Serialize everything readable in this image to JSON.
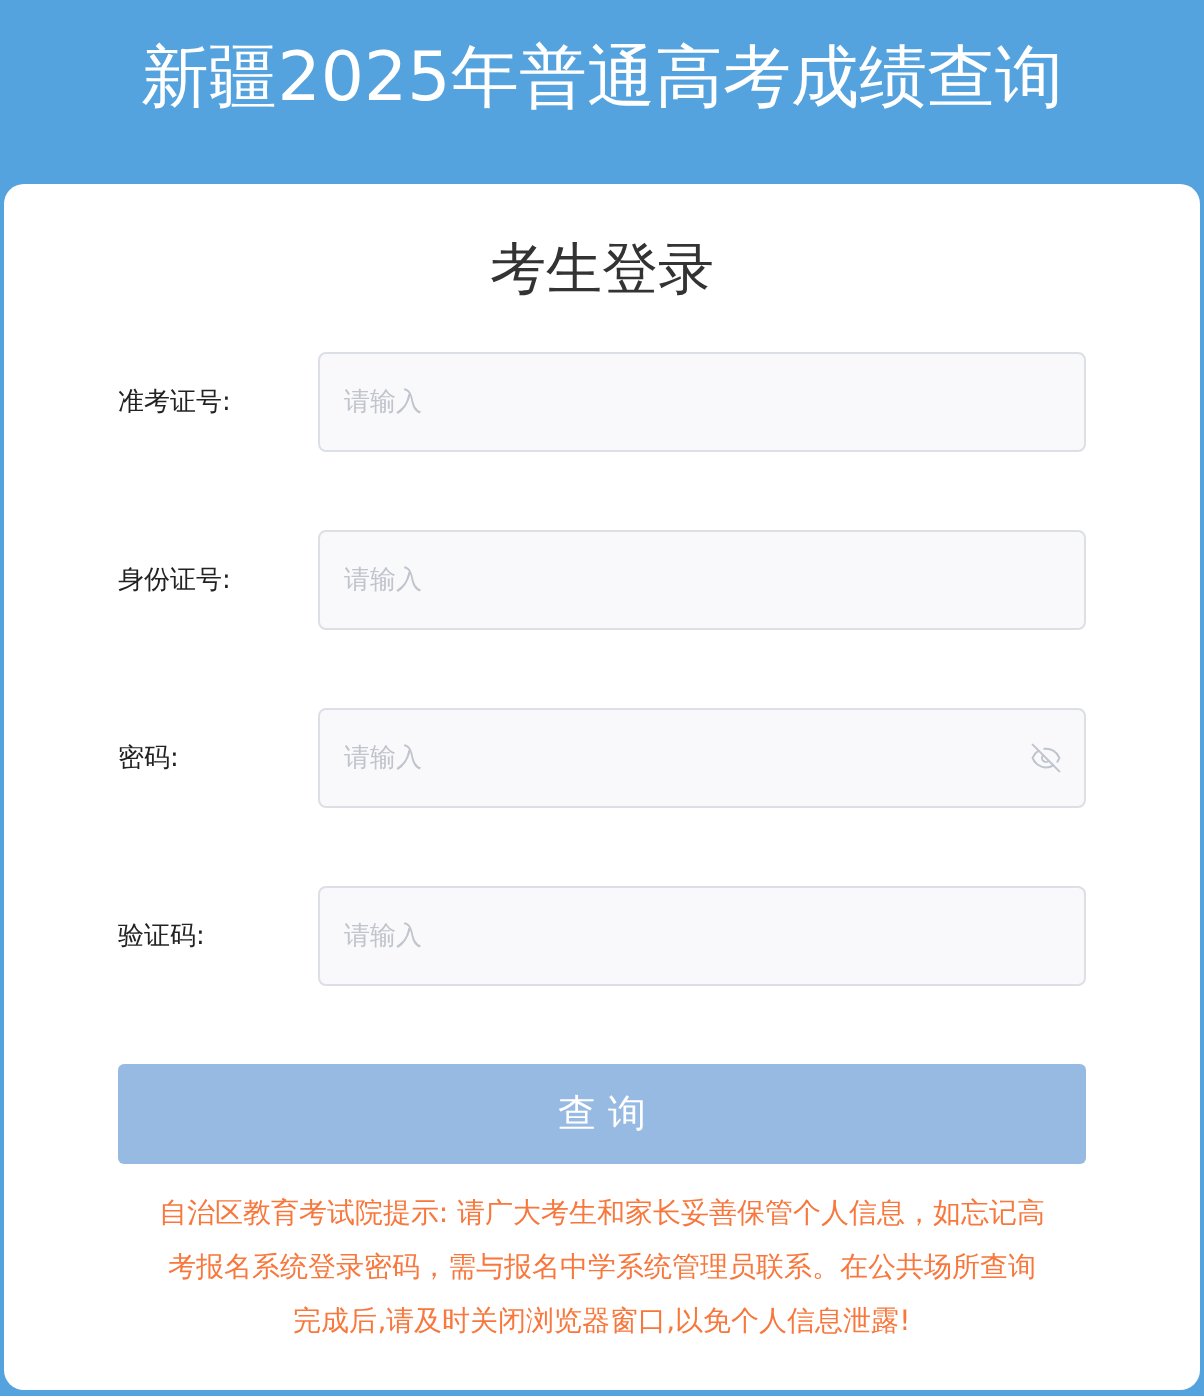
{
  "header": {
    "title": "新疆2025年普通高考成绩查询"
  },
  "login": {
    "title": "考生登录",
    "fields": [
      {
        "label": "准考证号:",
        "placeholder": "请输入",
        "kind": "text"
      },
      {
        "label": "身份证号:",
        "placeholder": "请输入",
        "kind": "text"
      },
      {
        "label": "密码:",
        "placeholder": "请输入",
        "kind": "password"
      },
      {
        "label": "验证码:",
        "placeholder": "请输入",
        "kind": "text"
      }
    ],
    "submit": "查 询",
    "notice": "自治区教育考试院提示: 请广大考生和家长妥善保管个人信息，如忘记高考报名系统登录密码，需与报名中学系统管理员联系。在公共场所查询完成后,请及时关闭浏览器窗口,以免个人信息泄露!"
  }
}
